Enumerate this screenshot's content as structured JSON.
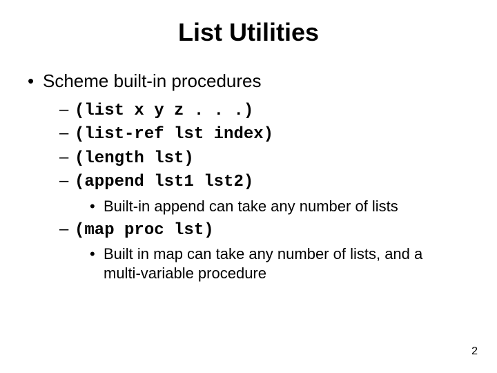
{
  "title": "List Utilities",
  "heading": "Scheme built-in procedures",
  "items": [
    {
      "code": "(list x y z . . .)"
    },
    {
      "code": "(list-ref lst index)"
    },
    {
      "code": "(length lst)"
    },
    {
      "code": "(append lst1 lst2)",
      "note": "Built-in append can take any number of lists"
    },
    {
      "code": "(map proc lst)",
      "note": "Built in map can take any number of lists, and a multi-variable procedure"
    }
  ],
  "page_number": "2"
}
